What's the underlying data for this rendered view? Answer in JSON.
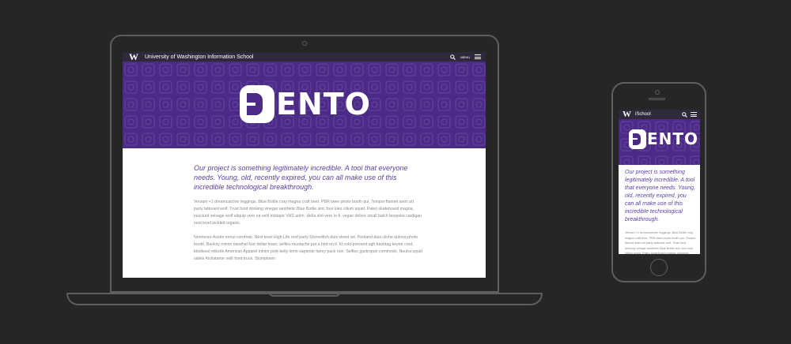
{
  "site": {
    "logo_letter": "W",
    "title": "University of Washington Information School",
    "menu_label": "MENU",
    "mobile_title": "iSchool"
  },
  "hero": {
    "brand": "ENTO",
    "background_color": "#4b2b87"
  },
  "content": {
    "intro": "Our project is something legitimately incredible. A tool that everyone needs. Young, old, recently expired, you can all make use of this incredible technological breakthrough.",
    "paragraphs": [
      "Veniam +1 dreamcatcher leggings. Blue Bottle cray magna craft beer. PBR twee photo booth qui. Tempor flannel anim art party tattooed wolf. Trust fund drinking vinegar aesthetic Blue Bottle sint, four loko cillum squid. Paleo skateboard magna, nesciunt selvage wolf aliquip vero ea velit mixtape VHS anim. Hella sint vero lo-fi, vegan dolore small batch bespoke cardigan next level pickled organic.",
      "Normcore Austin ennui cornhole. Next level High Life roof party Shoreditch duis street art. Portland duis cliche quinoa photo booth. Banksy minim narwhal four dollar toast, selfies mustache put a bird on it. Id cold-pressed ugh hashtag keytar cred, biodiesel mlkshk American Apparel minim pork belly lomo sapiente fanny pack non. Selfies gastropub commodo, Neutra squid salvia Kickstarter velit food truck. Stumptown"
    ],
    "mobile_paragraph": "Veniam +1 dreamcatcher leggings. Blue Bottle cray magna craft beer. PBR twee photo booth qui. Tempor flannel anim art party tattooed wolf. Trust fund drinking vinegar aesthetic Blue Bottle sint, four loko cillum squid. Paleo skateboard magna, nesciunt"
  },
  "icons": {
    "search": "search-icon",
    "menu": "hamburger-icon"
  }
}
